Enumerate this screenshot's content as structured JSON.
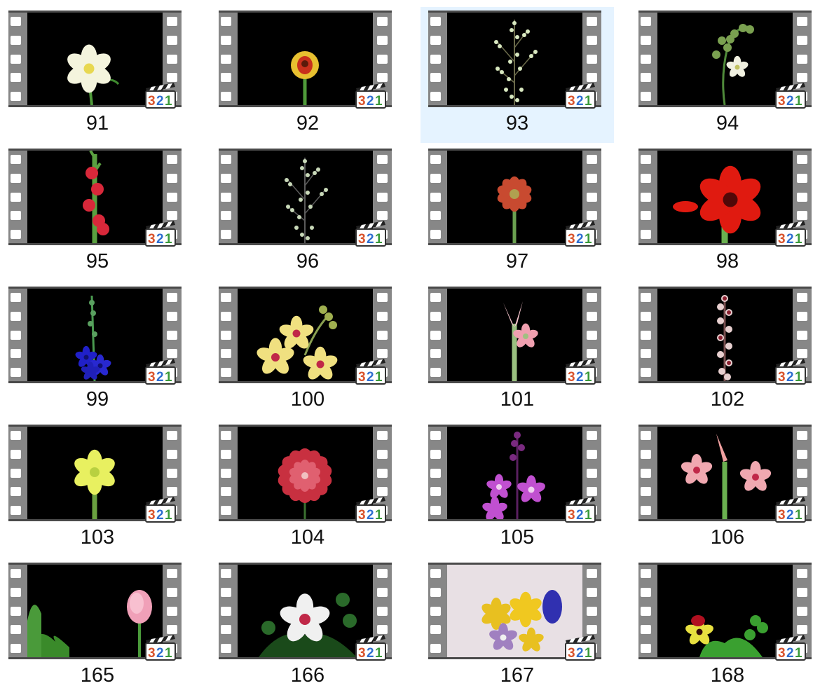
{
  "selected_index": 2,
  "items": [
    {
      "label": "91",
      "scene": "white-tulip"
    },
    {
      "label": "92",
      "scene": "red-yellow-bud"
    },
    {
      "label": "93",
      "scene": "blossom-branch"
    },
    {
      "label": "94",
      "scene": "orchid-buds"
    },
    {
      "label": "95",
      "scene": "red-gladiolus"
    },
    {
      "label": "96",
      "scene": "twig-buds"
    },
    {
      "label": "97",
      "scene": "dahlia-bud"
    },
    {
      "label": "98",
      "scene": "red-amaryllis"
    },
    {
      "label": "99",
      "scene": "blue-gladiolus"
    },
    {
      "label": "100",
      "scene": "yellow-orchid"
    },
    {
      "label": "101",
      "scene": "pink-lily"
    },
    {
      "label": "102",
      "scene": "bud-spike"
    },
    {
      "label": "103",
      "scene": "lime-lily"
    },
    {
      "label": "104",
      "scene": "red-dahlia"
    },
    {
      "label": "105",
      "scene": "purple-orchid"
    },
    {
      "label": "106",
      "scene": "pink-amaryllis"
    },
    {
      "label": "165",
      "scene": "pink-rose"
    },
    {
      "label": "166",
      "scene": "white-hibiscus"
    },
    {
      "label": "167",
      "scene": "crocus"
    },
    {
      "label": "168",
      "scene": "pansy"
    }
  ],
  "badge": {
    "text": "321",
    "digit_colors": [
      "#d9532c",
      "#2f6fd0",
      "#3a9a3a"
    ]
  },
  "colors": {
    "selection": "#e5f3ff",
    "film": "#878787",
    "film_edge": "#4a4a4a"
  }
}
